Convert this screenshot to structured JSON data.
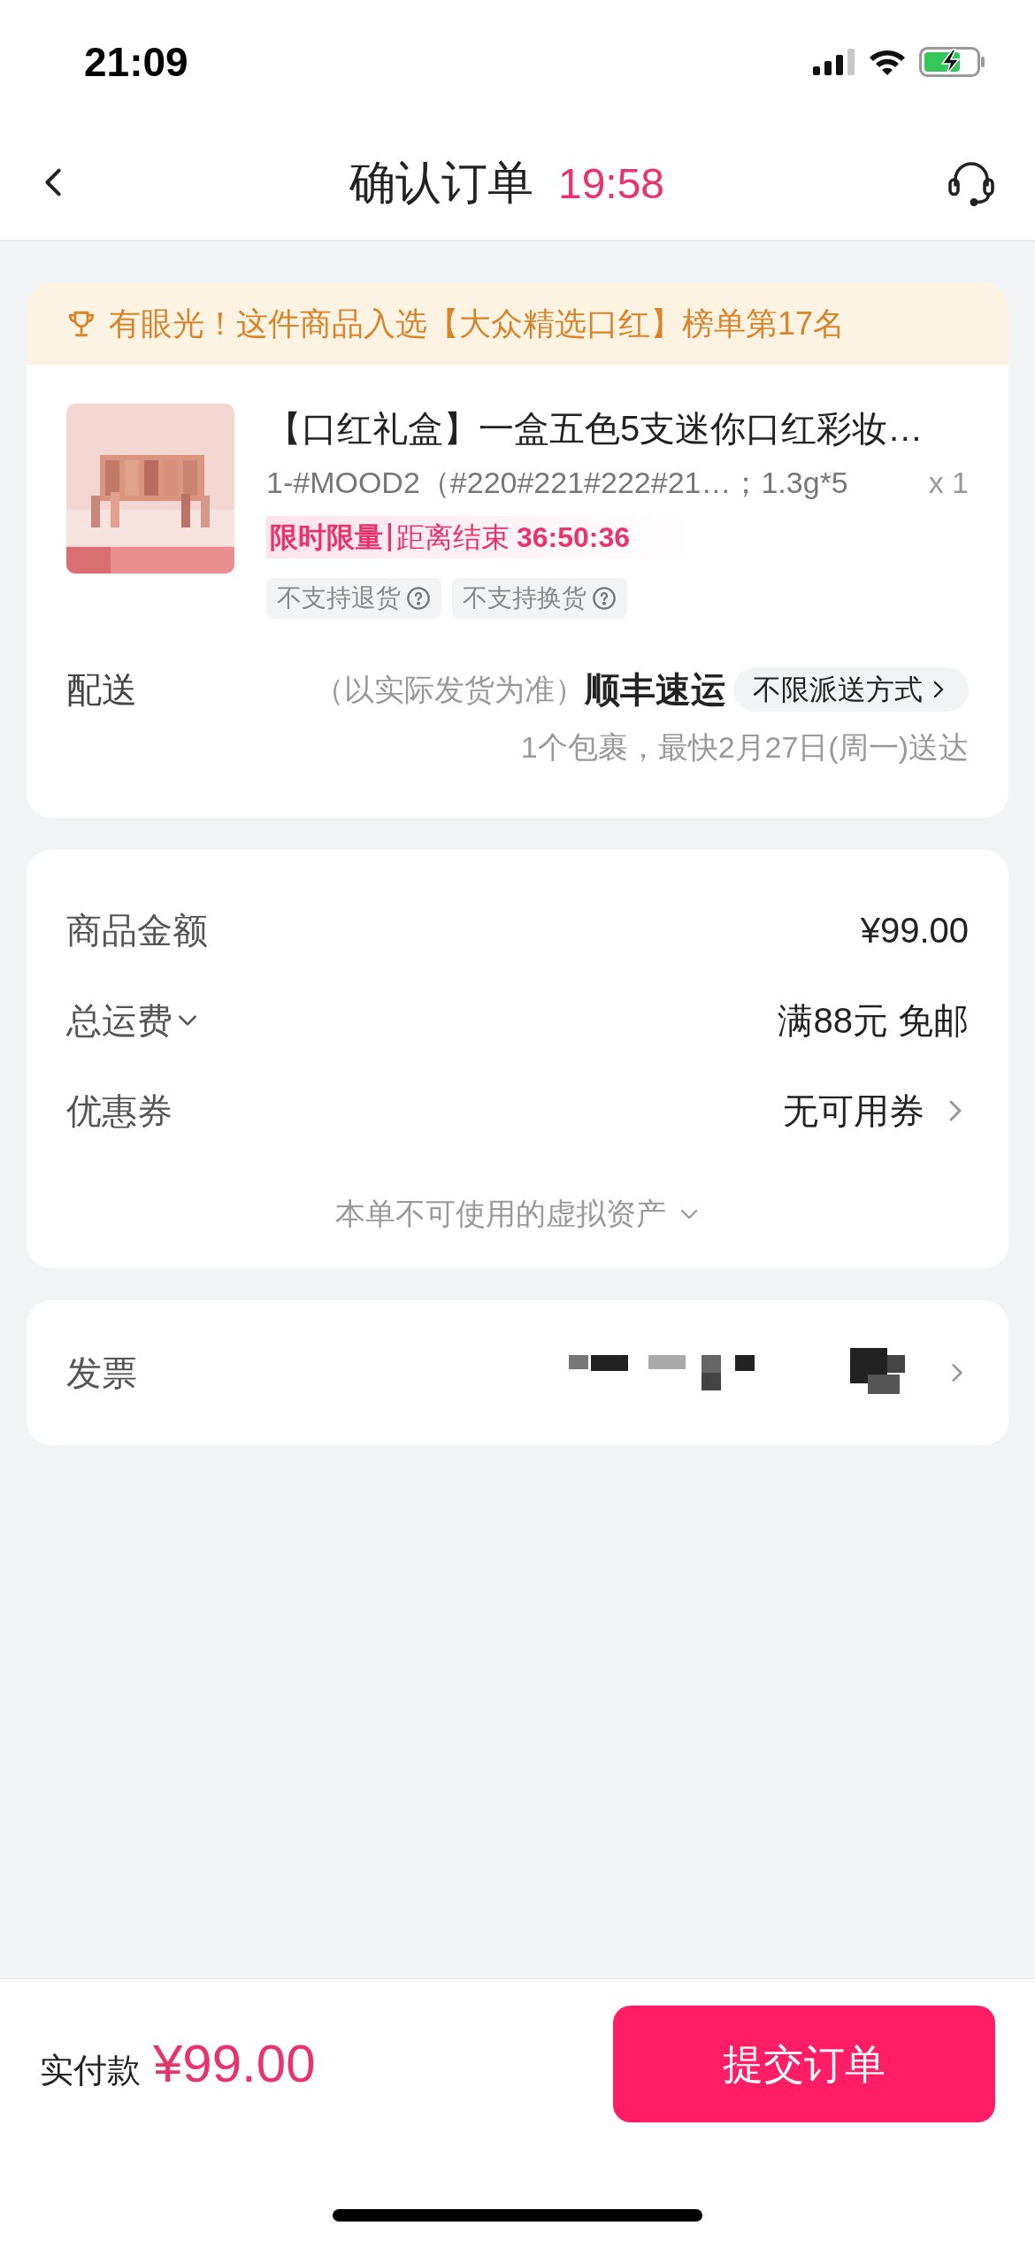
{
  "status_bar": {
    "time": "21:09"
  },
  "nav": {
    "title": "确认订单",
    "countdown": "19:58"
  },
  "ranking_banner": {
    "text": "有眼光！这件商品入选【大众精选口红】榜单第17名"
  },
  "product": {
    "title": "【口红礼盒】一盒五色5支迷你口红彩妆…",
    "variant": "1-#MOOD2（#220#221#222#21…；1.3g*5",
    "quantity": "x 1",
    "promo": {
      "label": "限时限量",
      "ends_label": "距离结束",
      "ends_in": "36:50:36"
    },
    "tags": [
      {
        "text": "不支持退货"
      },
      {
        "text": "不支持换货"
      }
    ]
  },
  "delivery": {
    "label": "配送",
    "note": "（以实际发货为准）",
    "carrier": "顺丰速运",
    "option": "不限派送方式",
    "eta": "1个包裹，最快2月27日(周一)送达"
  },
  "summary": {
    "rows": [
      {
        "kind": "plain",
        "label": "商品金额",
        "value": "¥99.00"
      },
      {
        "kind": "dropdown",
        "label": "总运费",
        "value": "满88元 免邮"
      },
      {
        "kind": "link",
        "label": "优惠券",
        "value": "无可用券"
      }
    ],
    "virtual_assets": "本单不可使用的虚拟资产"
  },
  "invoice": {
    "label": "发票",
    "value_redacted": true
  },
  "footer": {
    "label": "实付款",
    "amount": "¥99.00",
    "submit": "提交订单"
  }
}
